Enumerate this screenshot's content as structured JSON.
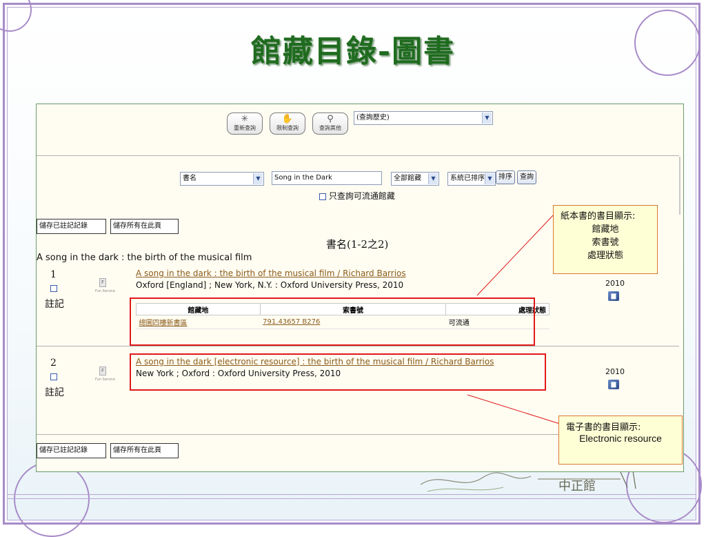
{
  "slide": {
    "title": "館藏目錄-圖書"
  },
  "toolbar": {
    "buttons": [
      {
        "label": "重新查詢",
        "icon": "star-icon"
      },
      {
        "label": "限制查詢",
        "icon": "hand-search-icon"
      },
      {
        "label": "查詢其他",
        "icon": "search-icon"
      }
    ],
    "history_select": "(查詢歷史)"
  },
  "search": {
    "field_select": "書名",
    "query": "Song in the Dark",
    "scope_select": "全部館藏",
    "sort_select": "系統已排序",
    "sort_button": "排序",
    "search_button": "查詢",
    "available_only_label": "只查詢可流通館藏"
  },
  "actions": {
    "save_marked": "儲存已註記記錄",
    "save_page": "儲存所有在此頁"
  },
  "results": {
    "heading": "書名(1-2之2)",
    "group_title": "A song in the dark : the birth of the musical film",
    "items": [
      {
        "number": "1",
        "mark_label": "註記",
        "thumb_caption": "Fun Service",
        "title_link": "A song in the dark : the birth of the musical film / Richard Barrios",
        "publication": "Oxford [England] ; New York, N.Y. : Oxford University Press, 2010",
        "year": "2010",
        "holdings": {
          "headers": [
            "館藏地",
            "索書號",
            "處理狀態"
          ],
          "rows": [
            {
              "location": "總圖四樓新書區",
              "call_number": "791.43657 B276",
              "status": "可流通"
            }
          ]
        }
      },
      {
        "number": "2",
        "mark_label": "註記",
        "thumb_caption": "Fun Service",
        "title_link": "A song in the dark [electronic resource] : the birth of the musical film / Richard Barrios",
        "publication": "New York ; Oxford : Oxford University Press, 2010",
        "year": "2010"
      }
    ]
  },
  "callouts": {
    "print": {
      "heading": "紙本書的書目顯示:",
      "lines": [
        "館藏地",
        "索書號",
        "處理狀態"
      ]
    },
    "electronic": {
      "heading": "電子書的書目顯示:",
      "line": "Electronic resource"
    }
  },
  "colors": {
    "frame": "#a78bc8",
    "title": "#1f6b1f",
    "highlight": "#e01818",
    "link": "#8a5a1a",
    "callout_bg": "#ffffd6"
  }
}
